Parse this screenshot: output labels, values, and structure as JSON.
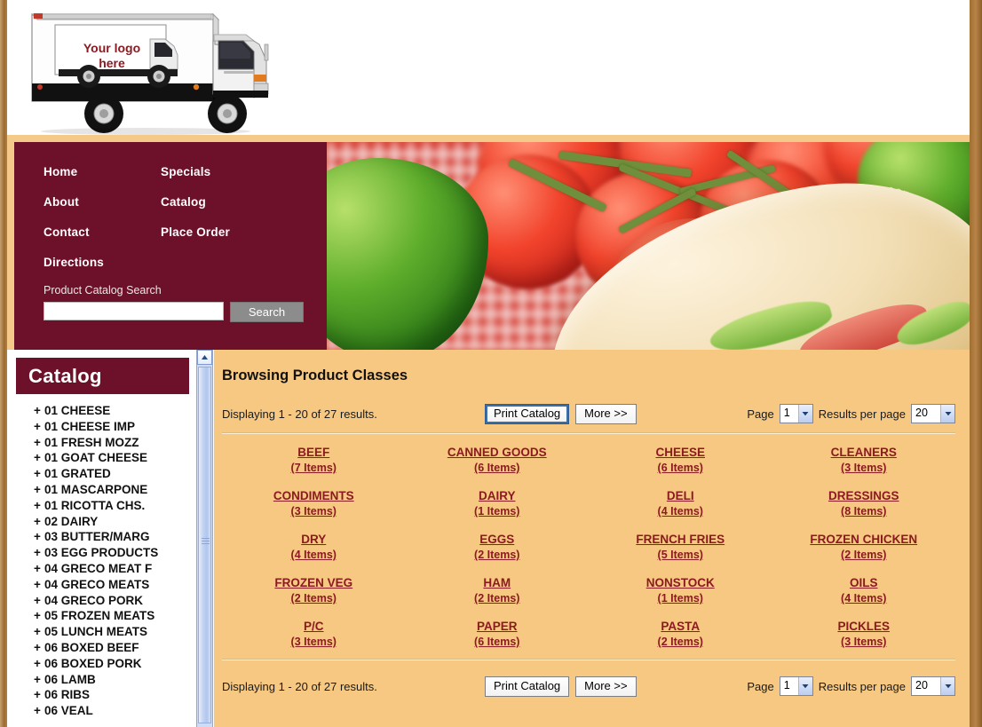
{
  "logo": {
    "line1": "Your logo",
    "line2": "here",
    "alt": "delivery-truck-logo"
  },
  "nav": {
    "column1": [
      {
        "label": "Home"
      },
      {
        "label": "About"
      },
      {
        "label": "Contact"
      },
      {
        "label": "Directions"
      }
    ],
    "column2": [
      {
        "label": "Specials"
      },
      {
        "label": "Catalog"
      },
      {
        "label": "Place Order"
      }
    ]
  },
  "search": {
    "label": "Product Catalog Search",
    "value": "",
    "placeholder": "",
    "button": "Search"
  },
  "sidebar": {
    "title": "Catalog",
    "expander": "+",
    "items": [
      "01 CHEESE",
      "01 CHEESE IMP",
      "01 FRESH MOZZ",
      "01 GOAT CHEESE",
      "01 GRATED",
      "01 MASCARPONE",
      "01 RICOTTA CHS.",
      "02 DAIRY",
      "03 BUTTER/MARG",
      "03 EGG PRODUCTS",
      "04 GRECO MEAT F",
      "04 GRECO MEATS",
      "04 GRECO PORK",
      "05 FROZEN MEATS",
      "05 LUNCH MEATS",
      "06 BOXED BEEF",
      "06 BOXED PORK",
      "06 LAMB",
      "06 RIBS",
      "06 VEAL"
    ]
  },
  "main": {
    "title": "Browsing Product Classes",
    "pager_top": {
      "displaying": "Displaying 1 - 20 of 27 results.",
      "print_label": "Print Catalog",
      "more_label": "More >>",
      "page_label": "Page",
      "page_value": "1",
      "results_label": "Results per page",
      "results_value": "20"
    },
    "pager_bottom": {
      "displaying": "Displaying 1 - 20 of 27 results.",
      "print_label": "Print Catalog",
      "more_label": "More >>",
      "page_label": "Page",
      "page_value": "1",
      "results_label": "Results per page",
      "results_value": "20"
    },
    "classes": [
      {
        "name": "BEEF",
        "count": "(7 Items)"
      },
      {
        "name": "CANNED GOODS",
        "count": "(6 Items)"
      },
      {
        "name": "CHEESE",
        "count": "(6 Items)"
      },
      {
        "name": "CLEANERS",
        "count": "(3 Items)"
      },
      {
        "name": "CONDIMENTS",
        "count": "(3 Items)"
      },
      {
        "name": "DAIRY",
        "count": "(1 Items)"
      },
      {
        "name": "DELI",
        "count": "(4 Items)"
      },
      {
        "name": "DRESSINGS",
        "count": "(8 Items)"
      },
      {
        "name": "DRY",
        "count": "(4 Items)"
      },
      {
        "name": "EGGS",
        "count": "(2 Items)"
      },
      {
        "name": "FRENCH FRIES",
        "count": "(5 Items)"
      },
      {
        "name": "FROZEN CHICKEN",
        "count": "(2 Items)"
      },
      {
        "name": "FROZEN VEG",
        "count": "(2 Items)"
      },
      {
        "name": "HAM",
        "count": "(2 Items)"
      },
      {
        "name": "NONSTOCK",
        "count": "(1 Items)"
      },
      {
        "name": "OILS",
        "count": "(4 Items)"
      },
      {
        "name": "P/C",
        "count": "(3 Items)"
      },
      {
        "name": "PAPER",
        "count": "(6 Items)"
      },
      {
        "name": "PASTA",
        "count": "(2 Items)"
      },
      {
        "name": "PICKLES",
        "count": "(3 Items)"
      }
    ]
  },
  "colors": {
    "maroon": "#6d1029",
    "link_red": "#8b1a21",
    "content_bg": "#f7c882",
    "frame_brown": "#a8763a",
    "scrollbar_blue": "#c3d4f2"
  }
}
